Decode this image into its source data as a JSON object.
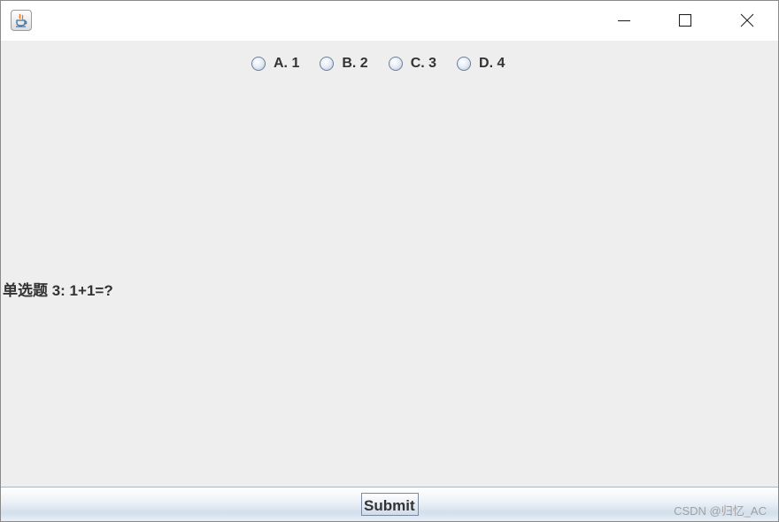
{
  "window": {
    "app_icon": "java-cup-icon",
    "controls": {
      "minimize": "minimize-icon",
      "maximize": "maximize-icon",
      "close": "close-icon"
    }
  },
  "options": [
    {
      "label": "A. 1",
      "selected": false
    },
    {
      "label": "B. 2",
      "selected": false
    },
    {
      "label": "C. 3",
      "selected": false
    },
    {
      "label": "D. 4",
      "selected": false
    }
  ],
  "question": {
    "prefix": "单选题",
    "text": " 3: 1+1=?"
  },
  "footer": {
    "submit_label": "Submit",
    "watermark": "CSDN @归忆_AC"
  },
  "colors": {
    "background": "#eeeeee",
    "text": "#333333",
    "watermark": "#a0a0a0",
    "titlebar": "#ffffff"
  }
}
